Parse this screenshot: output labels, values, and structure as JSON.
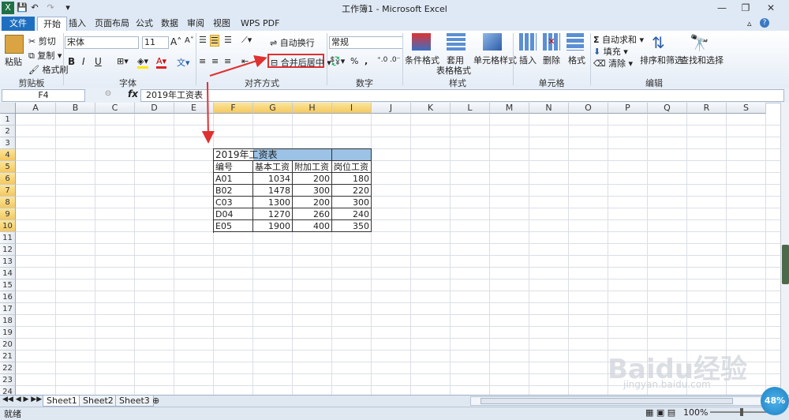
{
  "window": {
    "title": "工作簿1 - Microsoft Excel"
  },
  "tabs": [
    "文件",
    "开始",
    "插入",
    "页面布局",
    "公式",
    "数据",
    "审阅",
    "视图",
    "WPS PDF"
  ],
  "clipboard": {
    "paste": "粘贴",
    "cut": "剪切",
    "copy": "复制",
    "format_painter": "格式刷",
    "group": "剪贴板"
  },
  "font": {
    "name": "宋体",
    "size": "11",
    "bold": "B",
    "italic": "I",
    "underline": "U",
    "group": "字体"
  },
  "alignment": {
    "wrap_text": "自动换行",
    "merge_center": "合并后居中",
    "group": "对齐方式"
  },
  "number": {
    "format": "常规",
    "percent": "%",
    "comma": ",",
    "group": "数字"
  },
  "styles": {
    "conditional": "条件格式",
    "table_format_1": "套用",
    "table_format_2": "表格格式",
    "cell_styles": "单元格样式",
    "group": "样式"
  },
  "cells": {
    "insert": "插入",
    "delete": "删除",
    "format": "格式",
    "group": "单元格"
  },
  "editing": {
    "autosum": "自动求和",
    "fill": "填充",
    "clear": "清除",
    "sort": "排序和筛选",
    "find": "查找和选择",
    "group": "编辑"
  },
  "formula_bar": {
    "name_box": "F4",
    "fx": "fx",
    "content": "2019年工资表"
  },
  "columns": [
    "A",
    "B",
    "C",
    "D",
    "E",
    "F",
    "G",
    "H",
    "I",
    "J",
    "K",
    "L",
    "M",
    "N",
    "O",
    "P",
    "Q",
    "R",
    "S"
  ],
  "rows": [
    "1",
    "2",
    "3",
    "4",
    "5",
    "6",
    "7",
    "8",
    "9",
    "10",
    "11",
    "12",
    "13",
    "14",
    "15",
    "16",
    "17",
    "18",
    "19",
    "20",
    "21",
    "22",
    "23",
    "24"
  ],
  "table": {
    "title": "2019年工资表",
    "headers": [
      "编号",
      "基本工资",
      "附加工资",
      "岗位工资"
    ],
    "data": [
      [
        "A01",
        "1034",
        "200",
        "180"
      ],
      [
        "B02",
        "1478",
        "300",
        "220"
      ],
      [
        "C03",
        "1300",
        "200",
        "300"
      ],
      [
        "D04",
        "1270",
        "260",
        "240"
      ],
      [
        "E05",
        "1900",
        "400",
        "350"
      ]
    ]
  },
  "sheets": [
    "Sheet1",
    "Sheet2",
    "Sheet3"
  ],
  "status": {
    "ready": "就绪",
    "zoom": "100%",
    "badge": "48%"
  },
  "watermark": {
    "brand": "Baidu经验",
    "url": "jingyan.baidu.com"
  }
}
